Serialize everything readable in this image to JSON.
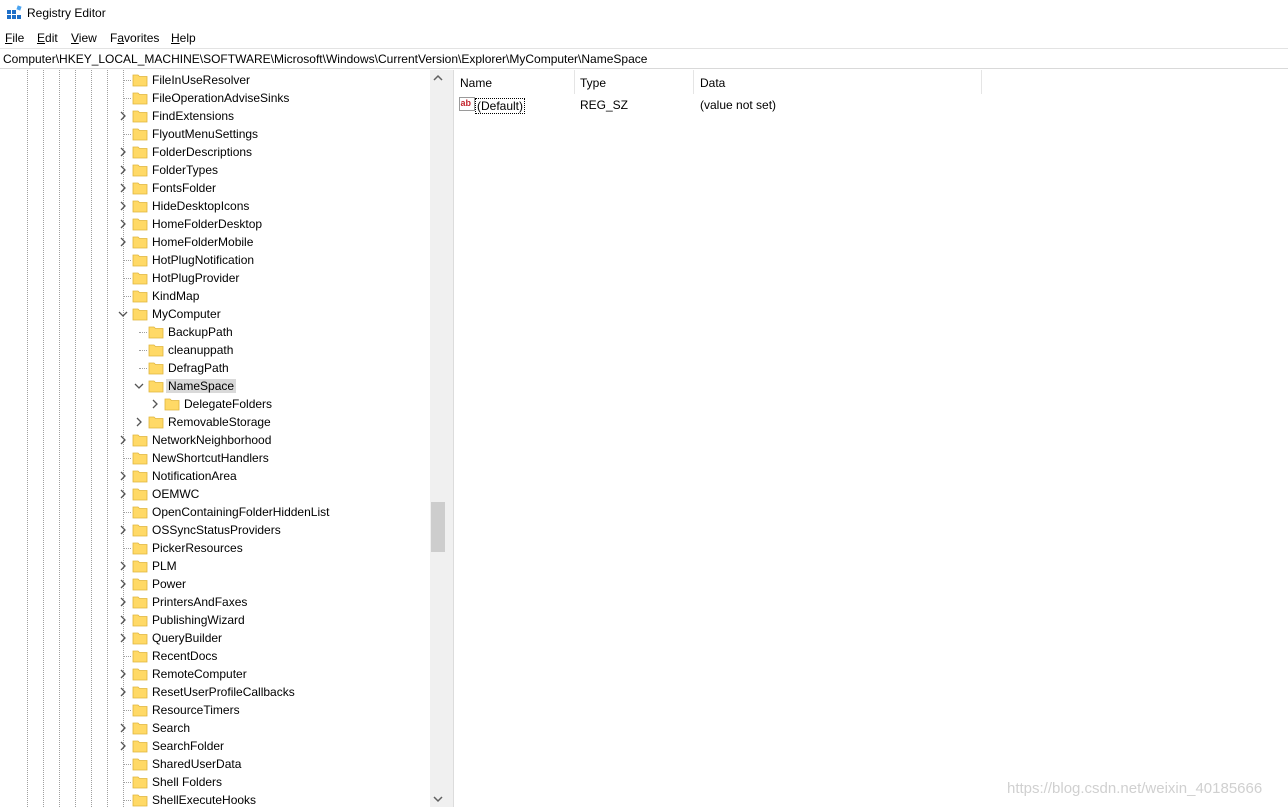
{
  "window": {
    "title": "Registry Editor"
  },
  "menu": [
    {
      "accel": "F",
      "rest": "ile"
    },
    {
      "accel": "E",
      "rest": "dit"
    },
    {
      "accel": "V",
      "rest": "iew"
    },
    {
      "accel": "",
      "pre": "F",
      "accel2": "a",
      "rest": "vorites"
    },
    {
      "accel": "H",
      "rest": "elp"
    }
  ],
  "address": "Computer\\HKEY_LOCAL_MACHINE\\SOFTWARE\\Microsoft\\Windows\\CurrentVersion\\Explorer\\MyComputer\\NameSpace",
  "tree": {
    "items": [
      {
        "label": "FileInUseResolver",
        "level": 0,
        "state": "leaf"
      },
      {
        "label": "FileOperationAdviseSinks",
        "level": 0,
        "state": "leaf"
      },
      {
        "label": "FindExtensions",
        "level": 0,
        "state": "collapsed"
      },
      {
        "label": "FlyoutMenuSettings",
        "level": 0,
        "state": "leaf"
      },
      {
        "label": "FolderDescriptions",
        "level": 0,
        "state": "collapsed"
      },
      {
        "label": "FolderTypes",
        "level": 0,
        "state": "collapsed"
      },
      {
        "label": "FontsFolder",
        "level": 0,
        "state": "collapsed"
      },
      {
        "label": "HideDesktopIcons",
        "level": 0,
        "state": "collapsed"
      },
      {
        "label": "HomeFolderDesktop",
        "level": 0,
        "state": "collapsed"
      },
      {
        "label": "HomeFolderMobile",
        "level": 0,
        "state": "collapsed"
      },
      {
        "label": "HotPlugNotification",
        "level": 0,
        "state": "leaf"
      },
      {
        "label": "HotPlugProvider",
        "level": 0,
        "state": "leaf"
      },
      {
        "label": "KindMap",
        "level": 0,
        "state": "leaf"
      },
      {
        "label": "MyComputer",
        "level": 0,
        "state": "expanded"
      },
      {
        "label": "BackupPath",
        "level": 1,
        "state": "leaf"
      },
      {
        "label": "cleanuppath",
        "level": 1,
        "state": "leaf"
      },
      {
        "label": "DefragPath",
        "level": 1,
        "state": "leaf"
      },
      {
        "label": "NameSpace",
        "level": 1,
        "state": "expanded",
        "selected": true
      },
      {
        "label": "DelegateFolders",
        "level": 2,
        "state": "collapsed"
      },
      {
        "label": "RemovableStorage",
        "level": 1,
        "state": "collapsed"
      },
      {
        "label": "NetworkNeighborhood",
        "level": 0,
        "state": "collapsed"
      },
      {
        "label": "NewShortcutHandlers",
        "level": 0,
        "state": "leaf"
      },
      {
        "label": "NotificationArea",
        "level": 0,
        "state": "collapsed"
      },
      {
        "label": "OEMWC",
        "level": 0,
        "state": "collapsed"
      },
      {
        "label": "OpenContainingFolderHiddenList",
        "level": 0,
        "state": "leaf"
      },
      {
        "label": "OSSyncStatusProviders",
        "level": 0,
        "state": "collapsed"
      },
      {
        "label": "PickerResources",
        "level": 0,
        "state": "leaf"
      },
      {
        "label": "PLM",
        "level": 0,
        "state": "collapsed"
      },
      {
        "label": "Power",
        "level": 0,
        "state": "collapsed"
      },
      {
        "label": "PrintersAndFaxes",
        "level": 0,
        "state": "collapsed"
      },
      {
        "label": "PublishingWizard",
        "level": 0,
        "state": "collapsed"
      },
      {
        "label": "QueryBuilder",
        "level": 0,
        "state": "collapsed"
      },
      {
        "label": "RecentDocs",
        "level": 0,
        "state": "leaf"
      },
      {
        "label": "RemoteComputer",
        "level": 0,
        "state": "collapsed"
      },
      {
        "label": "ResetUserProfileCallbacks",
        "level": 0,
        "state": "collapsed"
      },
      {
        "label": "ResourceTimers",
        "level": 0,
        "state": "leaf"
      },
      {
        "label": "Search",
        "level": 0,
        "state": "collapsed"
      },
      {
        "label": "SearchFolder",
        "level": 0,
        "state": "collapsed"
      },
      {
        "label": "SharedUserData",
        "level": 0,
        "state": "leaf"
      },
      {
        "label": "Shell Folders",
        "level": 0,
        "state": "leaf"
      },
      {
        "label": "ShellExecuteHooks",
        "level": 0,
        "state": "leaf"
      }
    ]
  },
  "list": {
    "columns": [
      "Name",
      "Type",
      "Data"
    ],
    "rows": [
      {
        "name": "(Default)",
        "type": "REG_SZ",
        "data": "(value not set)",
        "icon": "string-value-icon"
      }
    ]
  },
  "watermark": "https://blog.csdn.net/weixin_40185666",
  "colors": {
    "folder": "#ffd966",
    "folder_edge": "#e0b53c",
    "selection": "#d9d9d9",
    "icon_red": "#c4262e"
  }
}
